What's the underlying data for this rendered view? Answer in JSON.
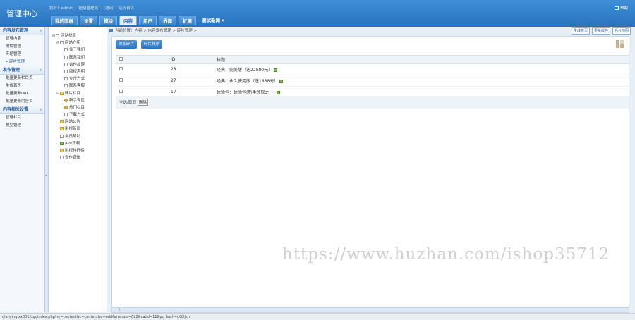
{
  "header": {
    "logo": "管理中心",
    "user_info": [
      "您好！admin",
      "[超级管理员]",
      "[退出]",
      "站点首页"
    ],
    "topright_label": "帮助"
  },
  "nav_tabs": [
    "我的面板",
    "设置",
    "模块",
    "内容",
    "用户",
    "界面",
    "扩展",
    "测试新闻 ▾"
  ],
  "nav_active": 3,
  "left_menu": {
    "sections": [
      {
        "title": "内容发布管理",
        "items": [
          "管理内容",
          "附件管理",
          "专题管理",
          "• 碎片管理"
        ]
      },
      {
        "title": "发布管理",
        "items": [
          "批量更新栏目页",
          "生成首页",
          "批量更新URL",
          "批量更新内容页"
        ]
      },
      {
        "title": "内容相关设置",
        "items": [
          "管理栏目",
          "模型管理"
        ]
      }
    ]
  },
  "tree": [
    {
      "indent": 0,
      "toggle": "⊟",
      "icon": "page",
      "label": "网站栏目"
    },
    {
      "indent": 1,
      "toggle": "⊟",
      "icon": "page",
      "label": "网站介绍"
    },
    {
      "indent": 2,
      "toggle": "",
      "icon": "page",
      "label": "关于我们"
    },
    {
      "indent": 2,
      "toggle": "",
      "icon": "page",
      "label": "联系我们"
    },
    {
      "indent": 2,
      "toggle": "",
      "icon": "page",
      "label": "合作加盟"
    },
    {
      "indent": 2,
      "toggle": "",
      "icon": "page",
      "label": "版权声明"
    },
    {
      "indent": 2,
      "toggle": "",
      "icon": "page",
      "label": "支付方式"
    },
    {
      "indent": 2,
      "toggle": "",
      "icon": "page",
      "label": "联系客服"
    },
    {
      "indent": 1,
      "toggle": "⊟",
      "icon": "open",
      "label": "碎片栏目"
    },
    {
      "indent": 2,
      "toggle": "",
      "icon": "dot",
      "label": "新手专区"
    },
    {
      "indent": 2,
      "toggle": "",
      "icon": "dot",
      "label": "热门栏目"
    },
    {
      "indent": 2,
      "toggle": "",
      "icon": "page",
      "label": "下载方式"
    },
    {
      "indent": 1,
      "toggle": "",
      "icon": "folder",
      "label": "网站公告"
    },
    {
      "indent": 1,
      "toggle": "",
      "icon": "folder",
      "label": "影视新闻"
    },
    {
      "indent": 1,
      "toggle": "",
      "icon": "page",
      "label": "会员帮助"
    },
    {
      "indent": 1,
      "toggle": "",
      "icon": "img",
      "label": "APP下载"
    },
    {
      "indent": 1,
      "toggle": "",
      "icon": "folder",
      "label": "影视排行榜"
    },
    {
      "indent": 1,
      "toggle": "",
      "icon": "page",
      "label": "合作媒体"
    }
  ],
  "breadcrumb": "当前位置：内容 > 内容发布管理 > 碎片管理 >",
  "tool_buttons": [
    "生成首页",
    "更新缓存",
    "后台地图"
  ],
  "actions": [
    "添加碎片",
    "碎片排序"
  ],
  "table": {
    "headers": {
      "id": "ID",
      "title": "标题"
    },
    "rows": [
      {
        "id": "28",
        "title": "经典、完美版（送22880元）"
      },
      {
        "id": "27",
        "title": "经典、永久使用版（送1888元）"
      },
      {
        "id": "17",
        "title": "体验包：体验包(新手领取之一)"
      }
    ],
    "footer_label": "全选/取消",
    "footer_button": "删除"
  },
  "status_url": "dianying.xx001.top/index.php?m=content&c=content&a=add&menuid=822&catid=11&pc_hash=dGXjkn",
  "watermark": "https://www.huzhan.com/ishop35712"
}
